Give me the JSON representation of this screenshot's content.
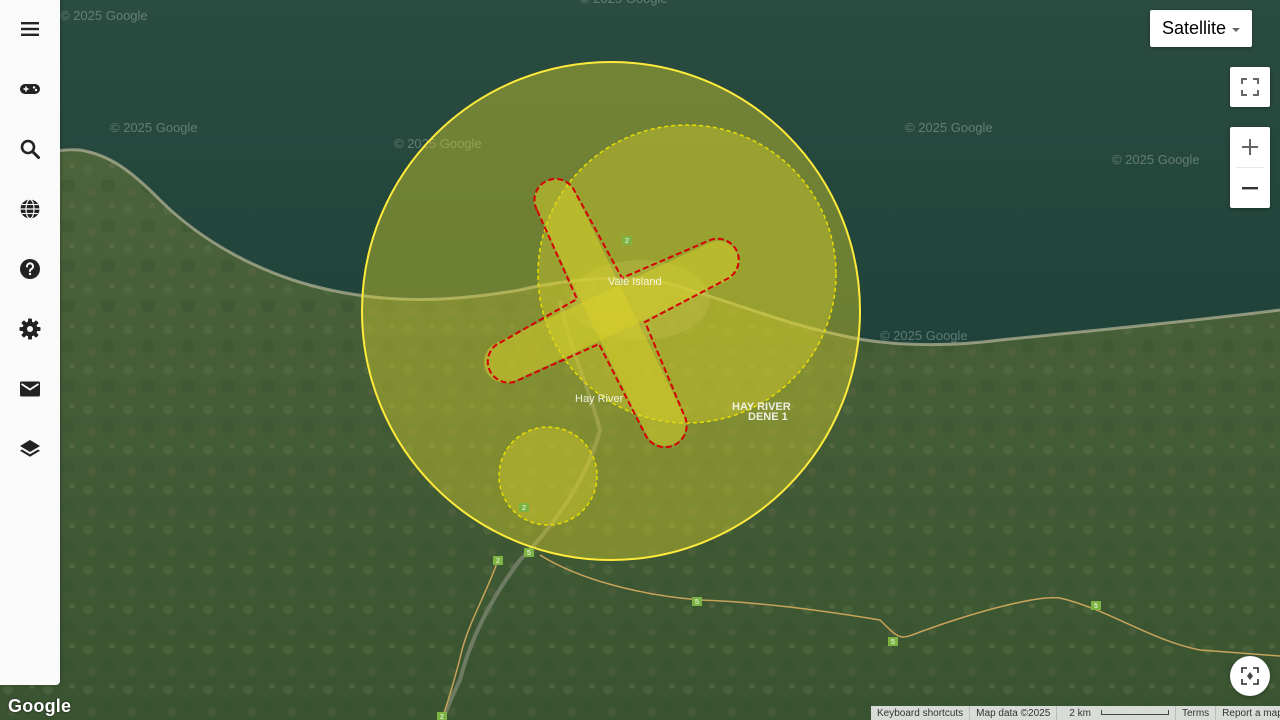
{
  "map": {
    "type": "Satellite",
    "watermark": "© 2025 Google",
    "labels": {
      "island": "Vale Island",
      "town": "Hay River",
      "reserve_line1": "HAY RIVER",
      "reserve_line2": "DENE 1"
    },
    "route_shields": [
      "2",
      "5",
      "2",
      "5",
      "5",
      "5",
      "2",
      "2"
    ]
  },
  "sidebar": {
    "items": [
      {
        "icon": "menu-icon"
      },
      {
        "icon": "gamepad-icon"
      },
      {
        "icon": "search-icon"
      },
      {
        "icon": "globe-icon"
      },
      {
        "icon": "help-icon"
      },
      {
        "icon": "gear-icon"
      },
      {
        "icon": "mail-icon"
      },
      {
        "icon": "layers-icon"
      }
    ]
  },
  "map_type_control": {
    "label": "Satellite"
  },
  "controls": {
    "fullscreen": "fullscreen-icon",
    "zoom_in": "zoom-in-icon",
    "zoom_out": "zoom-out-icon",
    "recenter": "recenter-icon"
  },
  "footer": {
    "logo": "Google",
    "keyboard": "Keyboard shortcuts",
    "map_data": "Map data ©2025",
    "scale": "2 km",
    "terms": "Terms",
    "report": "Report a map error"
  },
  "colors": {
    "zone_fill": "#d9d22a",
    "zone_stroke": "#ffeb3b",
    "runway_stroke": "#d50000",
    "water": "#22463c",
    "land": "#3e5a33"
  }
}
